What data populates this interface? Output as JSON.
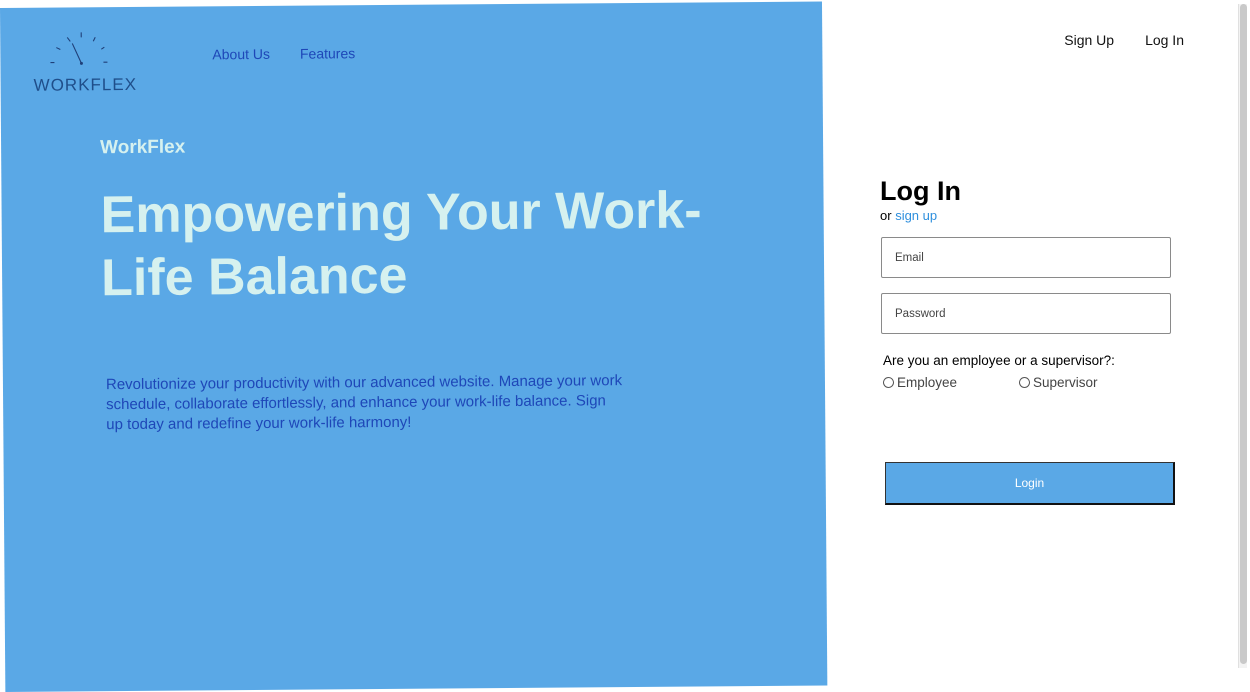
{
  "logo": {
    "text": "WORKFLEX",
    "icon": "clock-icon"
  },
  "nav": {
    "about": "About Us",
    "features": "Features"
  },
  "top_nav": {
    "sign_up": "Sign Up",
    "log_in": "Log In"
  },
  "hero": {
    "brand": "WorkFlex",
    "headline": "Empowering Your Work-Life Balance",
    "description": "Revolutionize your productivity with our advanced website. Manage your work schedule, collaborate effortlessly, and enhance your work-life balance. Sign up today and redefine your work-life harmony!"
  },
  "login": {
    "title": "Log In",
    "or_text": "or",
    "sign_up_link": "sign up",
    "email_placeholder": "Email",
    "password_placeholder": "Password",
    "role_question": "Are you an employee or a supervisor?:",
    "role_employee": "Employee",
    "role_supervisor": "Supervisor",
    "submit_label": "Login"
  },
  "colors": {
    "hero_bg": "#5aa8e6",
    "headline": "#d6f1ef",
    "nav_link": "#1e47b8",
    "link": "#2e8fdd"
  }
}
